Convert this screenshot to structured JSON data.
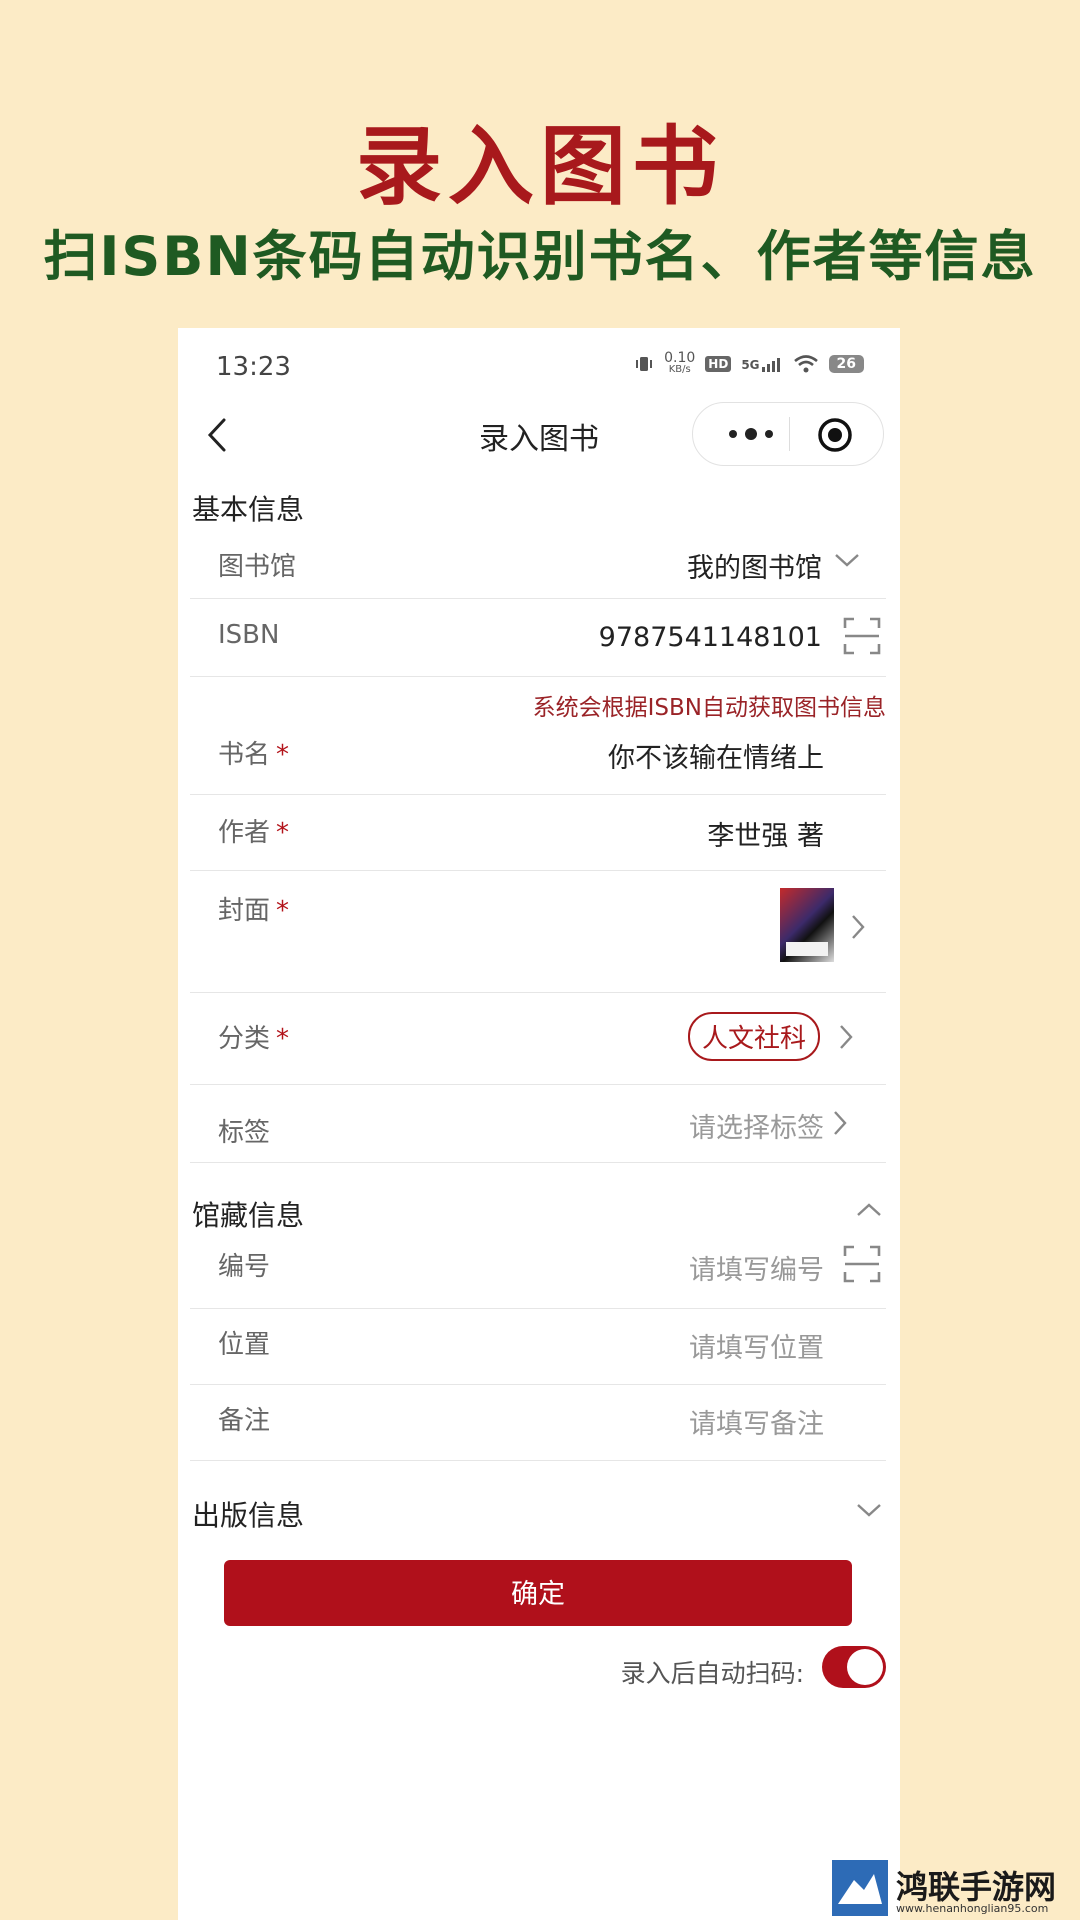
{
  "promo": {
    "title": "录入图书",
    "subtitle": "扫ISBN条码自动识别书名、作者等信息"
  },
  "status_bar": {
    "time": "13:23",
    "speed": "0.10",
    "speed_unit": "KB/s",
    "hd": "HD",
    "network": "5G",
    "battery": "26"
  },
  "nav": {
    "title": "录入图书"
  },
  "basic_info": {
    "section_title": "基本信息",
    "library_label": "图书馆",
    "library_value": "我的图书馆",
    "isbn_label": "ISBN",
    "isbn_value": "9787541148101",
    "hint": "系统会根据ISBN自动获取图书信息",
    "title_label": "书名",
    "title_value": "你不该输在情绪上",
    "author_label": "作者",
    "author_value": "李世强 著",
    "cover_label": "封面",
    "category_label": "分类",
    "category_value": "人文社科",
    "tags_label": "标签",
    "tags_placeholder": "请选择标签",
    "required_mark": "*"
  },
  "collection_info": {
    "section_title": "馆藏信息",
    "number_label": "编号",
    "number_placeholder": "请填写编号",
    "location_label": "位置",
    "location_placeholder": "请填写位置",
    "note_label": "备注",
    "note_placeholder": "请填写备注"
  },
  "publish_info": {
    "section_title": "出版信息"
  },
  "actions": {
    "confirm_label": "确定",
    "auto_scan_label": "录入后自动扫码:",
    "auto_scan_enabled": true
  },
  "watermark": {
    "name": "鸿联手游网",
    "url": "www.henanhonglian95.com"
  },
  "colors": {
    "accent": "#b0101b",
    "background": "#fcebc6",
    "promo_title": "#a8191c",
    "promo_subtitle": "#1f5a22"
  }
}
